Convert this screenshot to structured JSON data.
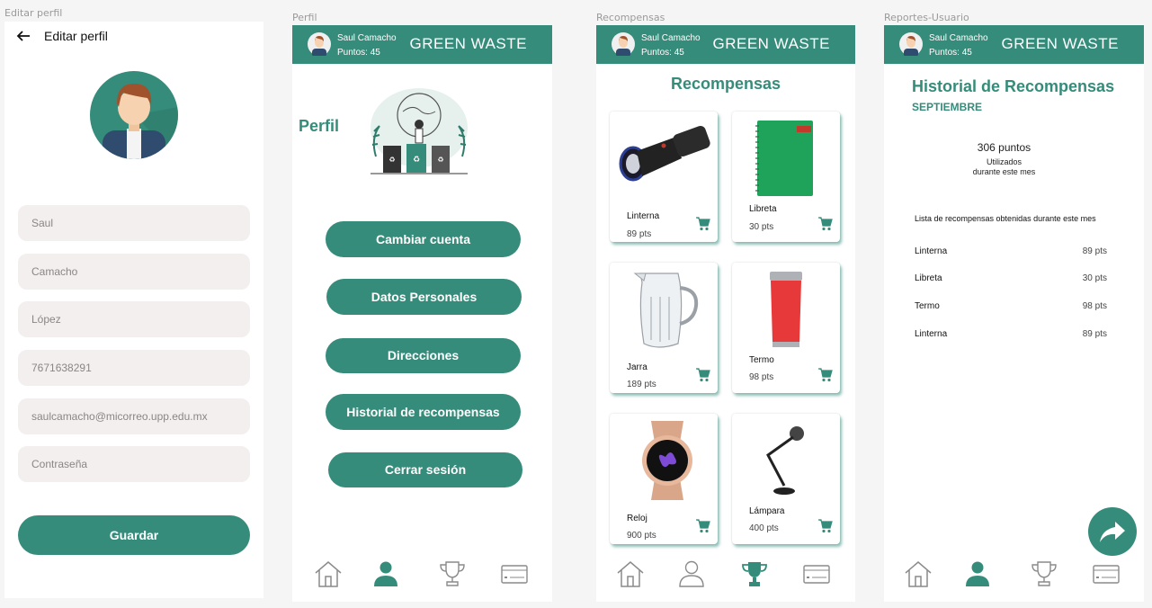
{
  "labels": {
    "edit": "Editar perfil",
    "profile": "Perfil",
    "rewards": "Recompensas",
    "reports": "Reportes-Usuario"
  },
  "header": {
    "user_name": "Saul Camacho",
    "points": "Puntos: 45",
    "brand": "GREEN WASTE"
  },
  "edit": {
    "back_icon": "arrow-left-icon",
    "title": "Editar perfil",
    "fields": [
      "Saul",
      "Camacho",
      "López",
      "7671638291",
      "saulcamacho@micorreo.upp.edu.mx",
      "Contraseña"
    ],
    "save": "Guardar"
  },
  "profile": {
    "title": "Perfil",
    "buttons": [
      "Cambiar cuenta",
      "Datos Personales",
      "Direcciones",
      "Historial de recompensas",
      "Cerrar sesión"
    ]
  },
  "rewards": {
    "title": "Recompensas",
    "items": [
      {
        "name": "Linterna",
        "pts": "89 pts"
      },
      {
        "name": "Libreta",
        "pts": "30 pts"
      },
      {
        "name": "Jarra",
        "pts": "189 pts"
      },
      {
        "name": "Termo",
        "pts": "98 pts"
      },
      {
        "name": "Reloj",
        "pts": "900 pts"
      },
      {
        "name": "Lámpara",
        "pts": "400 pts"
      }
    ]
  },
  "history": {
    "title": "Historial de Recompensas",
    "month": "SEPTIEMBRE",
    "points": "306 puntos",
    "used_1": "Utilizados",
    "used_2": "durante este mes",
    "list_title": "Lista de recompensas obtenidas durante este mes",
    "rows": [
      {
        "name": "Linterna",
        "pts": "89 pts"
      },
      {
        "name": "Libreta",
        "pts": "30 pts"
      },
      {
        "name": "Termo",
        "pts": "98 pts"
      },
      {
        "name": "Linterna",
        "pts": "89 pts"
      }
    ]
  },
  "colors": {
    "accent": "#358c7b",
    "field_bg": "#f2efee",
    "icon_gray": "#9a9a9a"
  },
  "nav_icons": [
    "home-icon",
    "person-icon",
    "trophy-icon",
    "card-icon"
  ]
}
